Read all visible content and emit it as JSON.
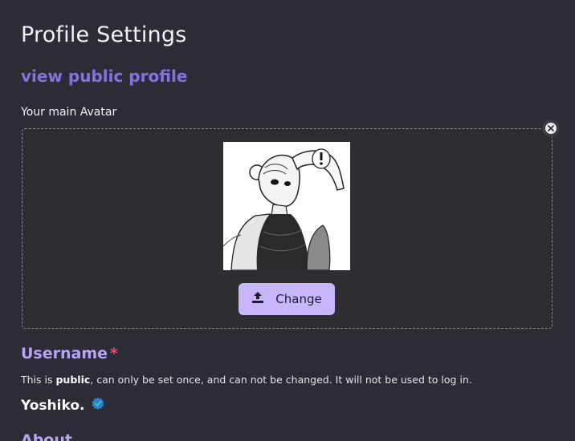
{
  "page": {
    "title": "Profile Settings",
    "public_link": "view public profile"
  },
  "avatar": {
    "label": "Your main Avatar",
    "change_label": "Change",
    "remove_icon": "close-circle-icon",
    "upload_icon": "upload-icon"
  },
  "username": {
    "title": "Username",
    "required_mark": "*",
    "hint_prefix": "This is ",
    "hint_bold": "public",
    "hint_suffix": ", can only be set once, and can not be changed. It will not be used to log in.",
    "value": "Yoshiko.",
    "verified_icon": "verified-badge-icon"
  },
  "about": {
    "title": "About"
  },
  "colors": {
    "background": "#2c2b36",
    "accent": "#8b6ee6",
    "button": "#c9b6fa",
    "required": "#e0536a"
  }
}
